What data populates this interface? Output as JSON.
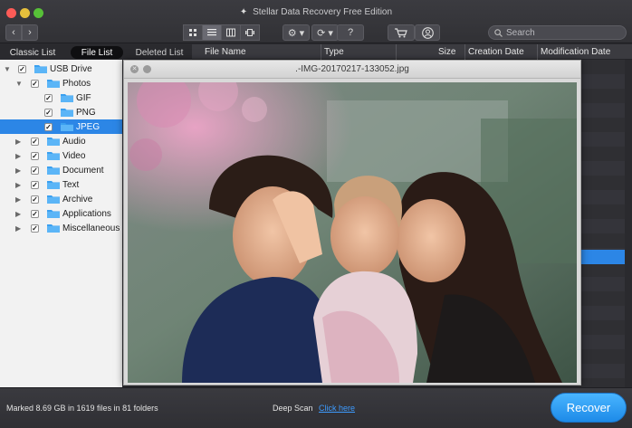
{
  "app": {
    "title": "Stellar Data Recovery Free Edition",
    "logo_glyph": "✦"
  },
  "toolbar": {
    "back_glyph": "‹",
    "forward_glyph": "›",
    "views": [
      "icon-view",
      "list-view",
      "column-view",
      "coverflow-view"
    ],
    "active_view": "list-view",
    "gear_glyph": "⚙ ▾",
    "refresh_glyph": "⟳ ▾",
    "help_glyph": "?",
    "cart_glyph": "🛒",
    "user_glyph": "◯",
    "search_placeholder": "Search"
  },
  "tabs": {
    "classic": "Classic List",
    "file": "File List",
    "deleted": "Deleted List"
  },
  "columns": {
    "file_name": "File Name",
    "type": "Type",
    "size": "Size",
    "creation_date": "Creation Date",
    "modification_date": "Modification Date"
  },
  "tree": {
    "items": [
      {
        "label": "USB Drive",
        "level": 0,
        "expanded": true,
        "checked": true,
        "selected": false
      },
      {
        "label": "Photos",
        "level": 1,
        "expanded": true,
        "checked": true,
        "selected": false
      },
      {
        "label": "GIF",
        "level": 2,
        "expanded": false,
        "checked": true,
        "selected": false
      },
      {
        "label": "PNG",
        "level": 2,
        "expanded": false,
        "checked": true,
        "selected": false
      },
      {
        "label": "JPEG",
        "level": 2,
        "expanded": false,
        "checked": true,
        "selected": true
      },
      {
        "label": "Audio",
        "level": 1,
        "expanded": false,
        "checked": true,
        "selected": false
      },
      {
        "label": "Video",
        "level": 1,
        "expanded": false,
        "checked": true,
        "selected": false
      },
      {
        "label": "Document",
        "level": 1,
        "expanded": false,
        "checked": true,
        "selected": false
      },
      {
        "label": "Text",
        "level": 1,
        "expanded": false,
        "checked": true,
        "selected": false
      },
      {
        "label": "Archive",
        "level": 1,
        "expanded": false,
        "checked": true,
        "selected": false
      },
      {
        "label": "Applications",
        "level": 1,
        "expanded": false,
        "checked": true,
        "selected": false
      },
      {
        "label": "Miscellaneous",
        "level": 1,
        "expanded": false,
        "checked": true,
        "selected": false
      }
    ]
  },
  "preview": {
    "title": ".-IMG-20170217-133052.jpg"
  },
  "status": {
    "marked": "Marked 8.69 GB in 1619 files in 81 folders",
    "deep_scan_label": "Deep Scan",
    "click_here": "Click here",
    "recover_label": "Recover"
  },
  "colors": {
    "accent": "#2c86e6",
    "recover": "#1d8ae8",
    "folder": "#3aa0f0"
  }
}
